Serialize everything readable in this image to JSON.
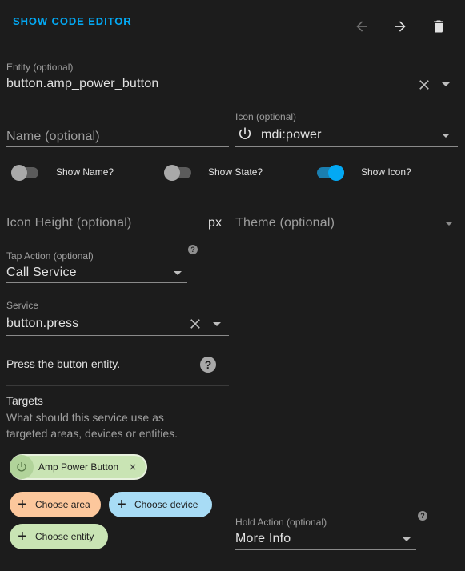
{
  "header": {
    "code_editor_label": "SHOW CODE EDITOR",
    "icons": {
      "back": "arrow-left-icon",
      "forward": "arrow-right-icon",
      "delete": "delete-icon"
    }
  },
  "entity": {
    "label": "Entity (optional)",
    "value": "button.amp_power_button"
  },
  "name": {
    "placeholder": "Name (optional)"
  },
  "icon_field": {
    "label": "Icon (optional)",
    "value": "mdi:power",
    "icon": "power-icon"
  },
  "toggles": [
    {
      "label": "Show Name?",
      "on": false
    },
    {
      "label": "Show State?",
      "on": false
    },
    {
      "label": "Show Icon?",
      "on": true
    }
  ],
  "icon_height": {
    "placeholder": "Icon Height (optional)",
    "suffix": "px"
  },
  "theme": {
    "placeholder": "Theme (optional)"
  },
  "tap_action": {
    "label": "Tap Action (optional)",
    "value": "Call Service",
    "help": "?"
  },
  "service": {
    "label": "Service",
    "value": "button.press",
    "description": "Press the button entity.",
    "help": "?"
  },
  "targets": {
    "title": "Targets",
    "description_line1": "What should this service use as",
    "description_line2": "targeted areas, devices or entities.",
    "entity_chip": {
      "label": "Amp Power Button",
      "icon": "power-icon"
    },
    "choose_area": "Choose area",
    "choose_device": "Choose device",
    "choose_entity": "Choose entity"
  },
  "hold_action": {
    "label": "Hold Action (optional)",
    "value": "More Info",
    "help": "?"
  },
  "colors": {
    "accent": "#03a9f4",
    "area_chip": "#fcc79c",
    "device_chip": "#a8dcf5",
    "entity_chip": "#c9e4b4"
  }
}
